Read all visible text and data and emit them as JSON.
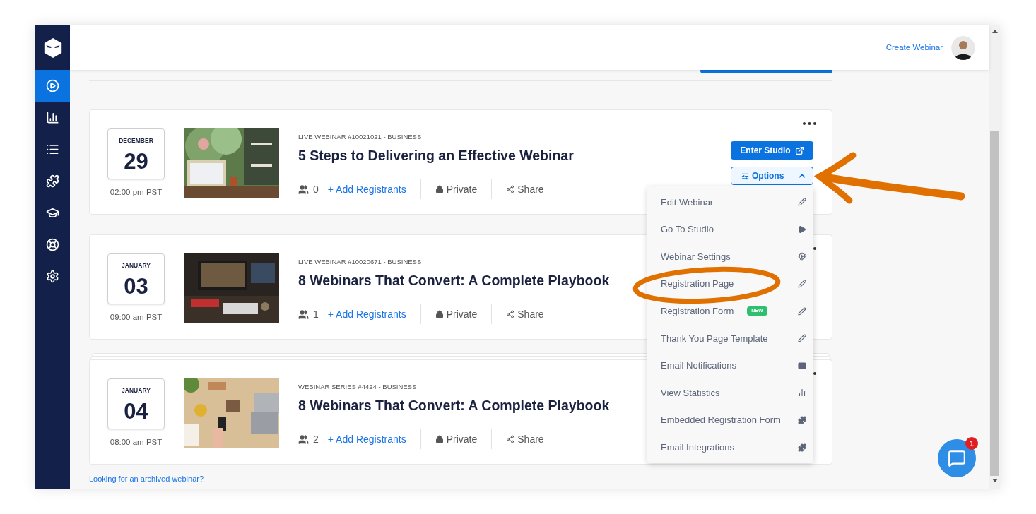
{
  "sidebar": {
    "items": [
      {
        "kind": "play",
        "selected": true
      },
      {
        "kind": "chart",
        "selected": false
      },
      {
        "kind": "list",
        "selected": false
      },
      {
        "kind": "puzzle",
        "selected": false
      },
      {
        "kind": "cap",
        "selected": false
      },
      {
        "kind": "lifebuoy",
        "selected": false
      },
      {
        "kind": "gear",
        "selected": false
      }
    ]
  },
  "header": {
    "create_link": "Create Webinar"
  },
  "webinars": [
    {
      "month": "DECEMBER",
      "day": "29",
      "time": "02:00 pm PST",
      "category": "LIVE WEBINAR #10021021 - BUSINESS",
      "title": "5 Steps to Delivering an Effective Webinar",
      "registrants": "0",
      "add_link": "+ Add Registrants",
      "privacy": "Private",
      "share": "Share",
      "enter_button": "Enter Studio",
      "options_button": "Options",
      "expanded": true,
      "stacked": false
    },
    {
      "month": "JANUARY",
      "day": "03",
      "time": "09:00 am PST",
      "category": "LIVE WEBINAR #10020671 - BUSINESS",
      "title": "8 Webinars That Convert: A Complete Playbook",
      "registrants": "1",
      "add_link": "+ Add Registrants",
      "privacy": "Private",
      "share": "Share",
      "stacked": false
    },
    {
      "month": "JANUARY",
      "day": "04",
      "time": "08:00 am PST",
      "category": "WEBINAR SERIES #4424 - BUSINESS",
      "title": "8 Webinars That Convert: A Complete Playbook",
      "registrants": "2",
      "add_link": "+ Add Registrants",
      "privacy": "Private",
      "share": "Share",
      "stacked": true
    }
  ],
  "options_menu": {
    "items": [
      {
        "label": "Edit Webinar",
        "kind": "pencil"
      },
      {
        "label": "Go To Studio",
        "kind": "play"
      },
      {
        "label": "Webinar Settings",
        "kind": "gears"
      },
      {
        "label": "Registration Page",
        "kind": "pencil"
      },
      {
        "label": "Registration Form",
        "badge": "NEW",
        "kind": "pencil"
      },
      {
        "label": "Thank You Page Template",
        "kind": "pencil"
      },
      {
        "label": "Email Notifications",
        "kind": "mail"
      },
      {
        "label": "View Statistics",
        "kind": "bars"
      },
      {
        "label": "Embedded Registration Form",
        "kind": "puzzle"
      },
      {
        "label": "Email Integrations",
        "kind": "puzzle"
      }
    ]
  },
  "archive_link": "Looking for an archived webinar?",
  "chat": {
    "badge": "1"
  }
}
